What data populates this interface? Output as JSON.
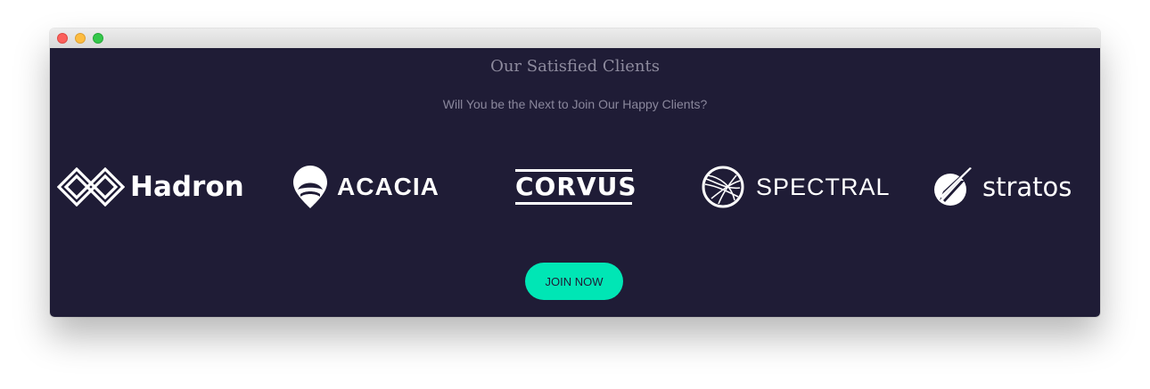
{
  "section": {
    "title": "Our Satisfied Clients",
    "subtitle": "Will You be the Next to Join Our Happy Clients?"
  },
  "clients": [
    {
      "name": "Hadron",
      "icon": "hadron-logo-icon"
    },
    {
      "name": "ACACIA",
      "icon": "acacia-logo-icon"
    },
    {
      "name": "CORVUS",
      "icon": "corvus-logo"
    },
    {
      "name": "SPECTRAL",
      "icon": "spectral-logo-icon"
    },
    {
      "name": "stratos",
      "icon": "stratos-logo-icon"
    }
  ],
  "cta": {
    "label": "JOIN NOW"
  },
  "colors": {
    "background": "#1f1c36",
    "accent": "#00e6b5",
    "muted_text": "#8a879c",
    "logo": "#ffffff"
  }
}
